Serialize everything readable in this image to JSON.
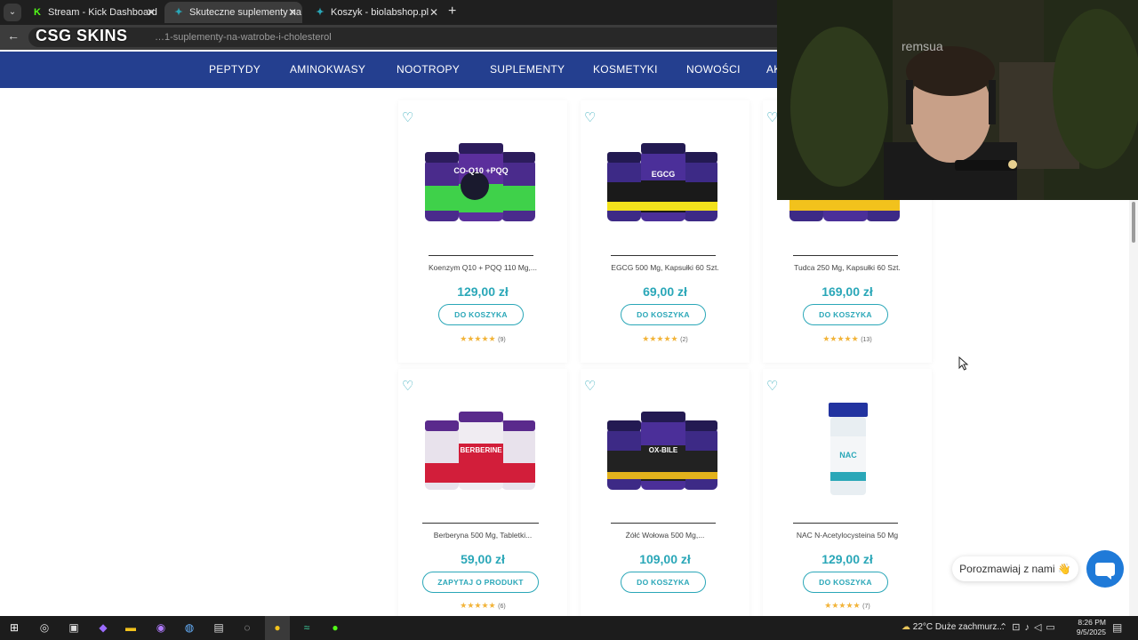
{
  "browser": {
    "tabs": [
      {
        "title": "Stream - Kick Dashboard",
        "active": false
      },
      {
        "title": "Skuteczne suplementy na wątrobę i cholesterol",
        "active": true
      },
      {
        "title": "Koszyk - biolabshop.pl",
        "active": false
      }
    ],
    "url": "…1-suplementy-na-watrobe-i-cholesterol"
  },
  "overlay_logo": "CSG SKINS",
  "nav": {
    "items": [
      "PEPTYDY",
      "AMINOKWASY",
      "NOOTROPY",
      "SUPLEMENTY",
      "KOSMETYKI",
      "NOWOŚCI",
      "AK"
    ]
  },
  "products": [
    {
      "name": "Koenzym Q10 + PQQ 110 Mg,...",
      "price": "129,00 zł",
      "cta": "DO KOSZYKA",
      "rating": "★★★★★",
      "reviews": "(9)",
      "image_label": "CO-Q10 +PQQ"
    },
    {
      "name": "EGCG 500 Mg, Kapsułki 60 Szt.",
      "price": "69,00 zł",
      "cta": "DO KOSZYKA",
      "rating": "★★★★★",
      "reviews": "(2)",
      "image_label": "EGCG"
    },
    {
      "name": "Tudca 250 Mg, Kapsułki 60 Szt.",
      "price": "169,00 zł",
      "cta": "DO KOSZYKA",
      "rating": "★★★★★",
      "reviews": "(13)",
      "image_label": ""
    },
    {
      "name": "Berberyna 500 Mg, Tabletki...",
      "price": "59,00 zł",
      "cta": "ZAPYTAJ O PRODUKT",
      "rating": "★★★★★",
      "reviews": "(6)",
      "image_label": "BERBERINE"
    },
    {
      "name": "Żółć Wołowa 500 Mg,...",
      "price": "109,00 zł",
      "cta": "DO KOSZYKA",
      "rating": "",
      "reviews": "",
      "image_label": "OX-BILE"
    },
    {
      "name": "NAC N-Acetylocysteina 50 Mg",
      "price": "129,00 zł",
      "cta": "DO KOSZYKA",
      "rating": "★★★★★",
      "reviews": "(7)",
      "image_label": "NAC"
    }
  ],
  "webcam": {
    "watermark": "remsua"
  },
  "chat": {
    "label": "Porozmawiaj z nami 👋"
  },
  "taskbar": {
    "weather_temp": "22°C",
    "weather_text": "Duże zachmurz...",
    "time": "8:26 PM",
    "date": "9/5/2025"
  },
  "colors": {
    "accent": "#2aa7b8",
    "nav_bg": "#243f8f",
    "chat_button": "#1f7ad8",
    "star": "#f2b43a"
  }
}
